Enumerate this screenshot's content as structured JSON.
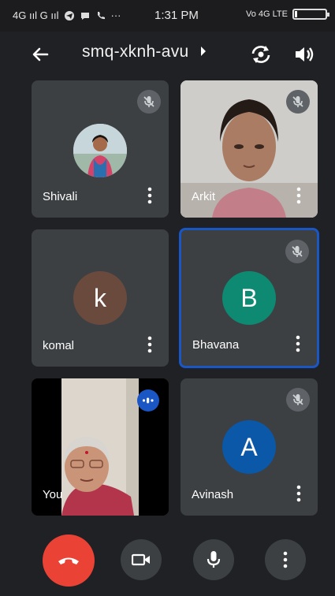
{
  "status_bar": {
    "left_text": "4G ııl G ııl",
    "time": "1:31 PM",
    "right_text": "Vo 4G LTE"
  },
  "header": {
    "meeting_code": "smq-xknh-avu"
  },
  "participants": [
    {
      "name": "Shivali",
      "muted": true,
      "avatar": "photo"
    },
    {
      "name": "Arkit",
      "muted": true,
      "avatar": "video"
    },
    {
      "name": "komal",
      "muted": false,
      "avatar": "letter",
      "letter": "k",
      "color": "#6b4a3e"
    },
    {
      "name": "Bhavana",
      "muted": true,
      "avatar": "letter",
      "letter": "B",
      "color": "#0f8a72",
      "active": true
    },
    {
      "name": "You",
      "muted": false,
      "avatar": "video",
      "speaking": true
    },
    {
      "name": "Avinash",
      "muted": true,
      "avatar": "letter",
      "letter": "A",
      "color": "#0b57a8"
    }
  ],
  "colors": {
    "background": "#202124",
    "tile": "#3c4043",
    "end_call": "#ea4335",
    "active_border": "#1a56c4"
  }
}
